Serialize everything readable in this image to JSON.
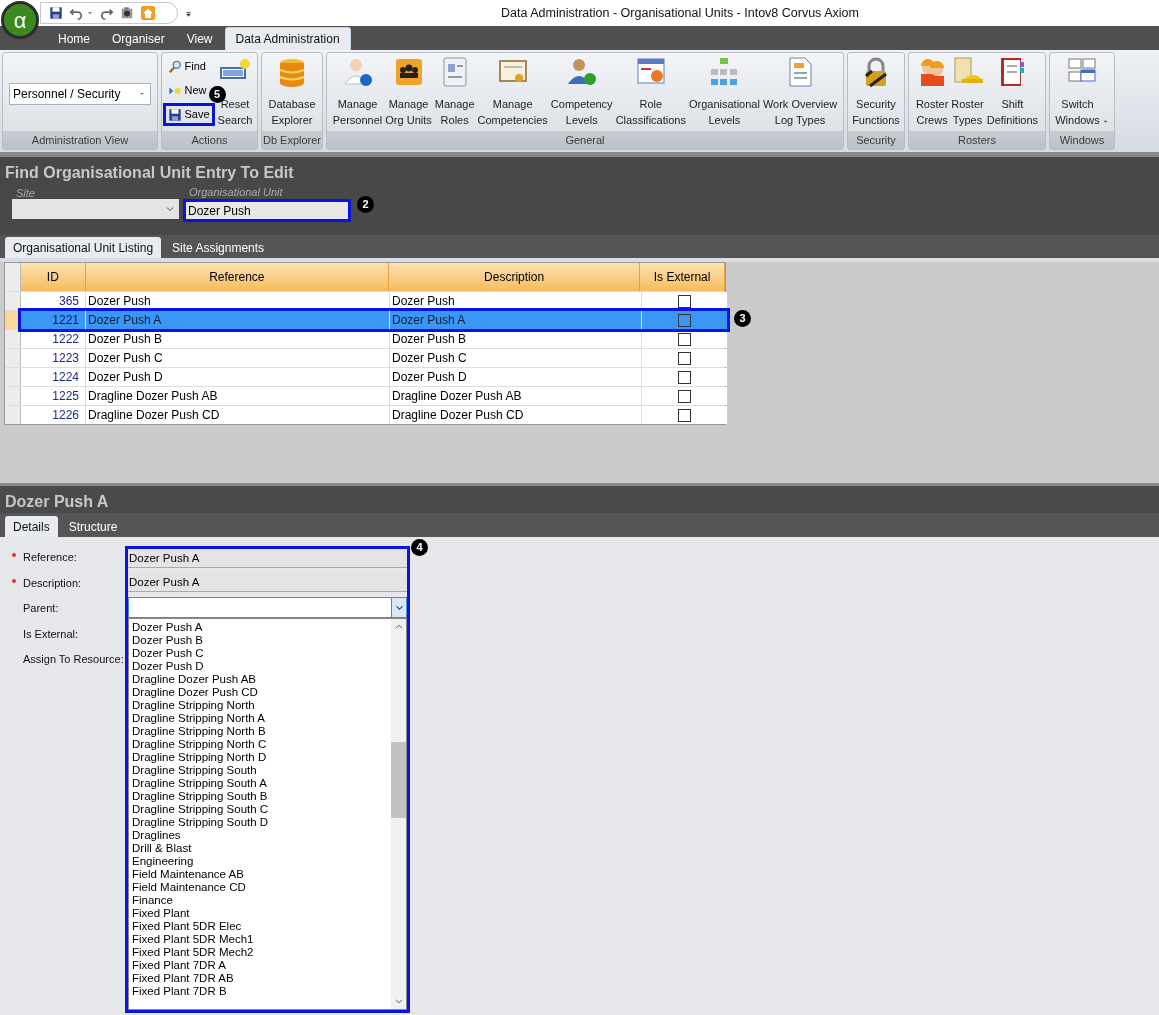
{
  "window": {
    "logo": "α",
    "title": "Data Administration - Organisational Units - Intov8 Corvus Axiom"
  },
  "menu_tabs": [
    {
      "label": "Home",
      "selected": false
    },
    {
      "label": "Organiser",
      "selected": false
    },
    {
      "label": "View",
      "selected": false
    },
    {
      "label": "Data Administration",
      "selected": true
    }
  ],
  "ribbon": [
    {
      "label": "Administration View",
      "items": [
        {
          "kind": "combo",
          "value": "Personnel / Security"
        }
      ]
    },
    {
      "label": "Actions",
      "items": [
        {
          "kind": "small",
          "label": "Find"
        },
        {
          "kind": "small",
          "label": "New"
        },
        {
          "kind": "small",
          "label": "Save",
          "callout": "5"
        },
        {
          "kind": "large",
          "label": "Reset\nSearch"
        }
      ]
    },
    {
      "label": "Db Explorer",
      "items": [
        {
          "kind": "large",
          "label": "Database\nExplorer"
        }
      ]
    },
    {
      "label": "General",
      "items": [
        {
          "kind": "large",
          "label": "Manage\nPersonnel"
        },
        {
          "kind": "large",
          "label": "Manage\nOrg Units"
        },
        {
          "kind": "large",
          "label": "Manage\nRoles"
        },
        {
          "kind": "large",
          "label": "Manage\nCompetencies"
        },
        {
          "kind": "large",
          "label": "Competency\nLevels"
        },
        {
          "kind": "large",
          "label": "Role\nClassifications"
        },
        {
          "kind": "large",
          "label": "Organisational\nLevels"
        },
        {
          "kind": "large",
          "label": "Work Overview\nLog Types"
        }
      ]
    },
    {
      "label": "Security",
      "items": [
        {
          "kind": "large",
          "label": "Security\nFunctions"
        }
      ]
    },
    {
      "label": "Rosters",
      "items": [
        {
          "kind": "large",
          "label": "Roster\nCrews"
        },
        {
          "kind": "large",
          "label": "Roster\nTypes"
        },
        {
          "kind": "large",
          "label": "Shift\nDefinitions"
        }
      ]
    },
    {
      "label": "Windows",
      "items": [
        {
          "kind": "large",
          "label": "Switch\nWindows",
          "has_menu": true
        }
      ]
    }
  ],
  "find_panel": {
    "title": "Find Organisational Unit Entry To Edit",
    "site": {
      "label": "Site"
    },
    "org_unit": {
      "label": "Organisational Unit",
      "value": "Dozer Push",
      "callout": "2"
    }
  },
  "listing_tabs": [
    {
      "label": "Organisational Unit Listing",
      "selected": true
    },
    {
      "label": "Site Assignments",
      "selected": false
    }
  ],
  "table": {
    "columns": [
      "ID",
      "Reference",
      "Description",
      "Is External"
    ],
    "rows": [
      {
        "id": "365",
        "reference": "Dozer Push",
        "description": "Dozer Push",
        "is_external": false,
        "selected": false
      },
      {
        "id": "1221",
        "reference": "Dozer Push A",
        "description": "Dozer Push A",
        "is_external": false,
        "selected": true,
        "callout": "3"
      },
      {
        "id": "1222",
        "reference": "Dozer Push B",
        "description": "Dozer Push B",
        "is_external": false,
        "selected": false
      },
      {
        "id": "1223",
        "reference": "Dozer Push C",
        "description": "Dozer Push C",
        "is_external": false,
        "selected": false
      },
      {
        "id": "1224",
        "reference": "Dozer Push D",
        "description": "Dozer Push D",
        "is_external": false,
        "selected": false
      },
      {
        "id": "1225",
        "reference": "Dragline Dozer Push AB",
        "description": "Dragline Dozer Push AB",
        "is_external": false,
        "selected": false
      },
      {
        "id": "1226",
        "reference": "Dragline Dozer Push CD",
        "description": "Dragline Dozer Push CD",
        "is_external": false,
        "selected": false
      }
    ]
  },
  "detail": {
    "title": "Dozer Push A",
    "tabs": [
      {
        "label": "Details",
        "selected": true
      },
      {
        "label": "Structure",
        "selected": false
      }
    ],
    "fields": [
      {
        "label": "Reference:",
        "required": true
      },
      {
        "label": "Description:",
        "required": true
      },
      {
        "label": "Parent:",
        "required": false
      },
      {
        "label": "Is External:",
        "required": false
      },
      {
        "label": "Assign To Resource:",
        "required": false
      }
    ],
    "controls": {
      "callout": "4",
      "reference": "Dozer Push A",
      "description": "Dozer Push A",
      "parent_options": [
        "Dozer Push A",
        "Dozer Push B",
        "Dozer Push C",
        "Dozer Push D",
        "Dragline Dozer Push AB",
        "Dragline Dozer Push CD",
        "Dragline Stripping North",
        "Dragline Stripping North A",
        "Dragline Stripping North B",
        "Dragline Stripping North C",
        "Dragline Stripping North D",
        "Dragline Stripping South",
        "Dragline Stripping South A",
        "Dragline Stripping South B",
        "Dragline Stripping South C",
        "Dragline Stripping South D",
        "Draglines",
        "Drill & Blast",
        "Engineering",
        "Field Maintenance AB",
        "Field Maintenance CD",
        "Finance",
        "Fixed Plant",
        "Fixed Plant 5DR Elec",
        "Fixed Plant 5DR Mech1",
        "Fixed Plant 5DR Mech2",
        "Fixed Plant 7DR A",
        "Fixed Plant 7DR AB",
        "Fixed Plant 7DR B"
      ]
    }
  }
}
